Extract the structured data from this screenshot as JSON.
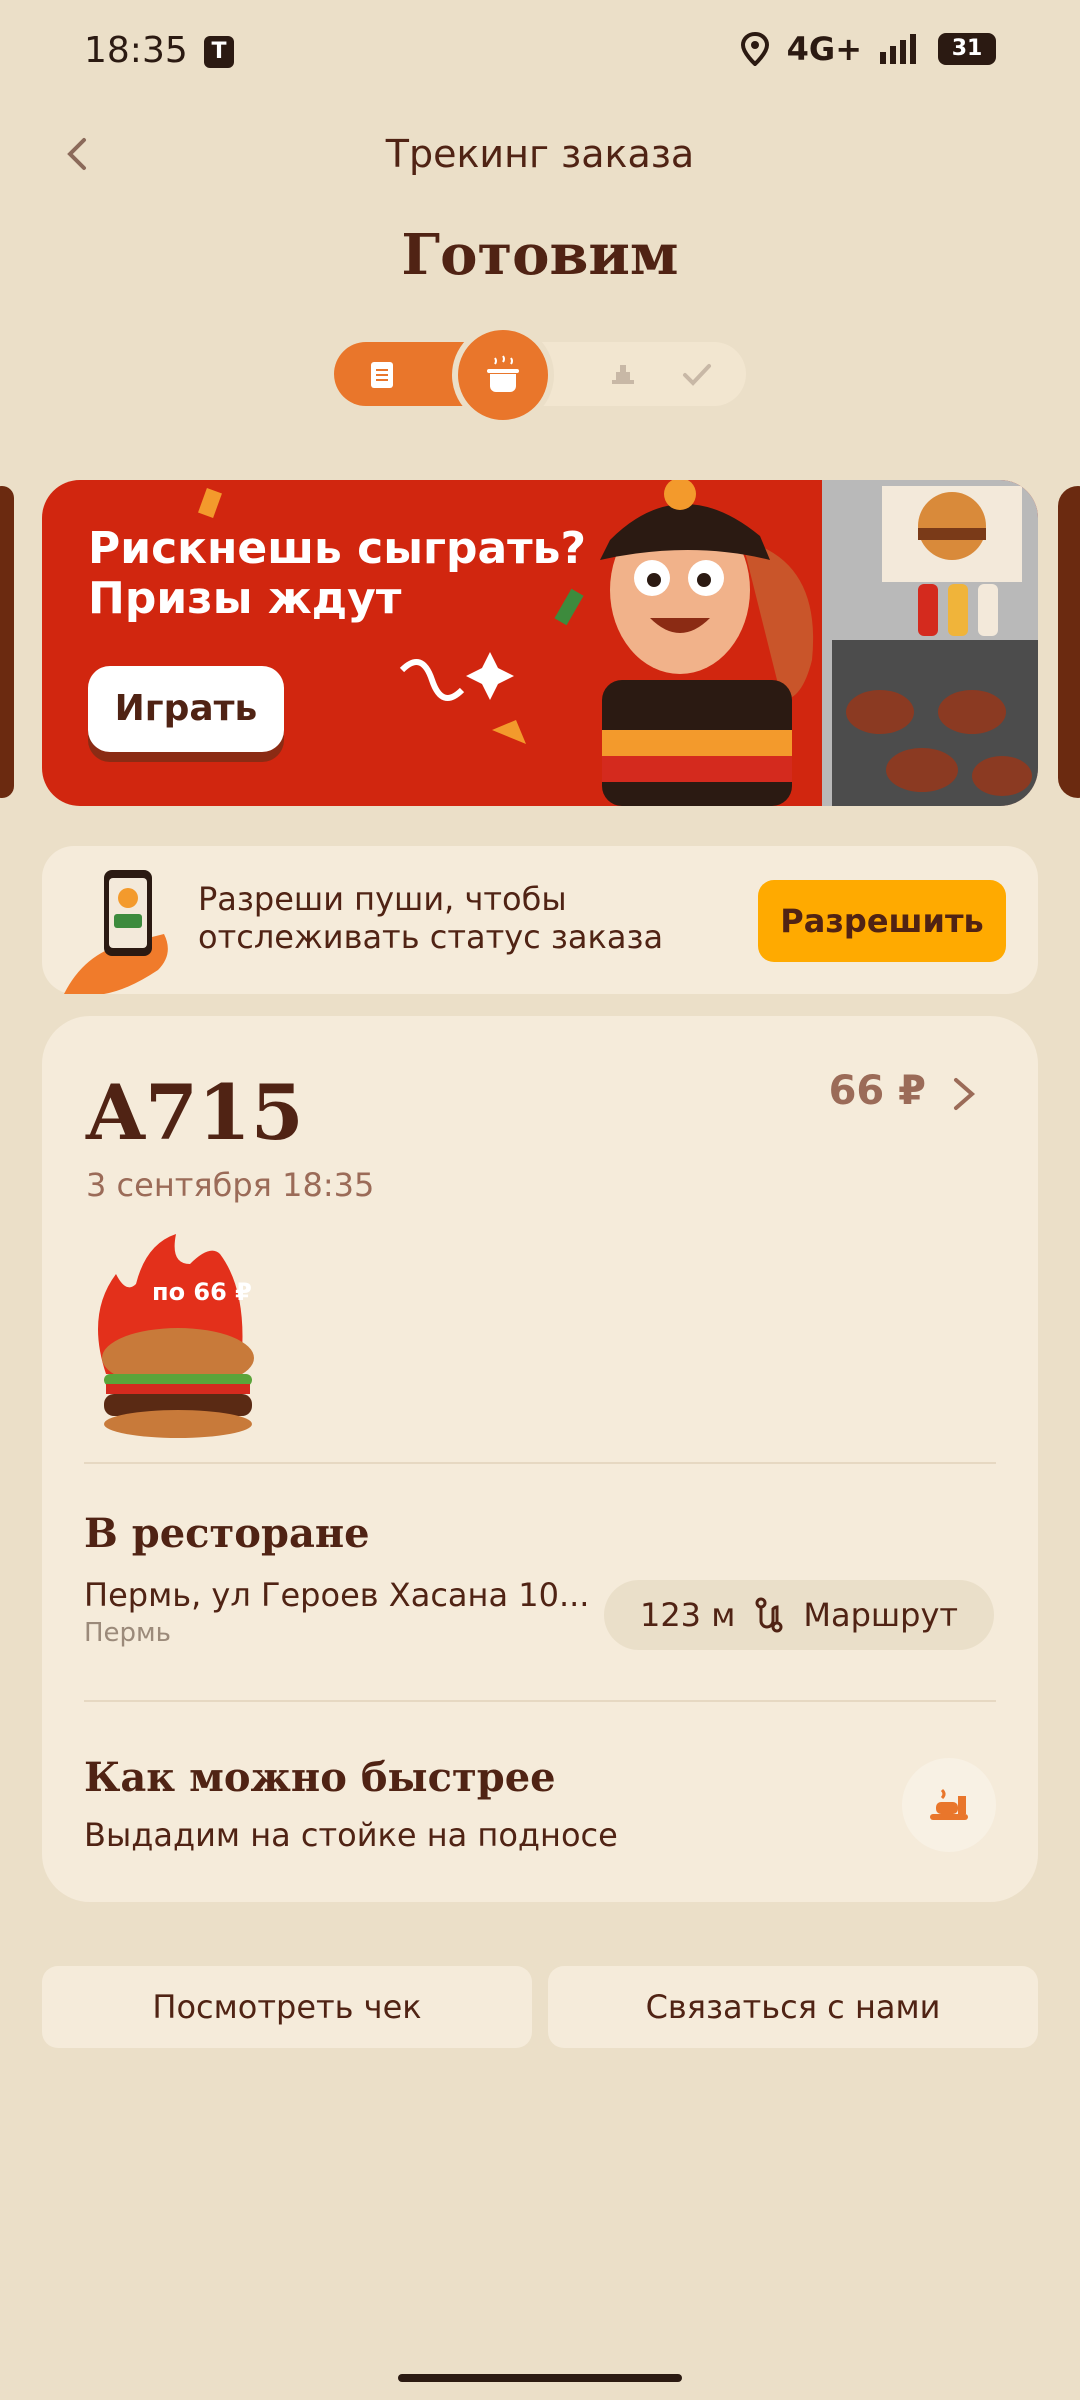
{
  "status_bar": {
    "time": "18:35",
    "network": "4G+",
    "battery": "31"
  },
  "header": {
    "title": "Трекинг заказа",
    "status": "Готовим"
  },
  "banner": {
    "title": "Рискнешь сыграть?\nПризы ждут",
    "button": "Играть"
  },
  "push": {
    "text": "Разреши пуши, чтобы\nотслеживать статус заказа",
    "button": "Разрешить"
  },
  "order": {
    "number": "A715",
    "date": "3 сентября 18:35",
    "price": "66 ₽",
    "product_badge": "по 66 ₽",
    "location_title": "В ресторане",
    "address": "Пермь, ул Героев Хасана 10...",
    "city": "Пермь",
    "distance": "123 м",
    "route_label": "Маршрут",
    "delivery_title": "Как можно быстрее",
    "delivery_desc": "Выдадим на стойке на подносе"
  },
  "actions": {
    "receipt": "Посмотреть чек",
    "contact": "Связаться с нами"
  },
  "colors": {
    "background": "#EBDFC8",
    "accent": "#E9762B",
    "brand_brown": "#502314",
    "banner_red": "#D1260F",
    "cta_yellow": "#FFAA00"
  }
}
